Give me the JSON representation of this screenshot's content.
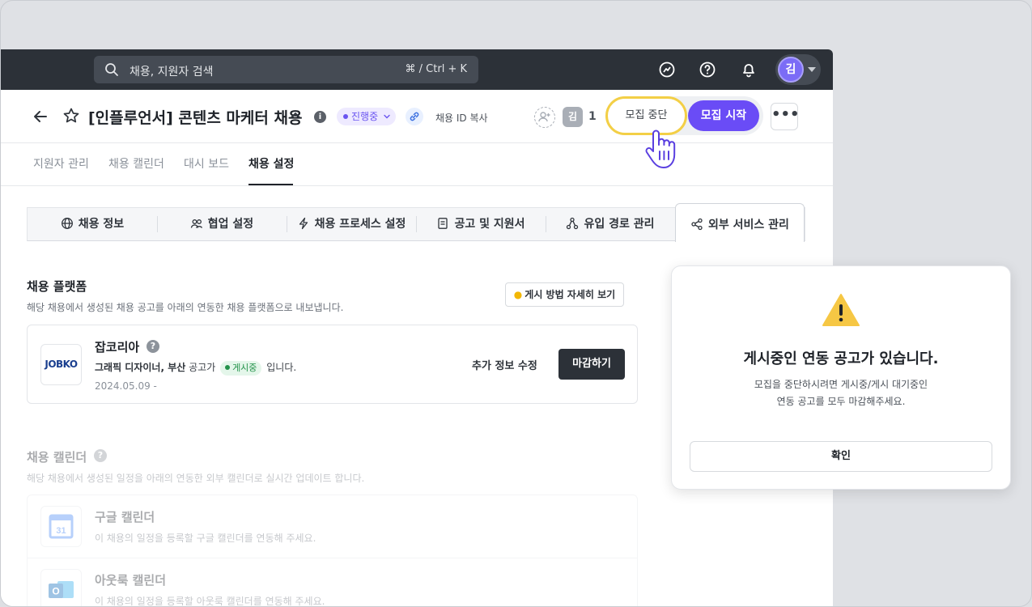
{
  "topbar": {
    "search_placeholder": "채용, 지원자 검색",
    "search_shortcut": "⌘ / Ctrl + K",
    "avatar_initial": "김"
  },
  "header": {
    "job_title": "[인플루언서] 콘텐츠 마케터 채용",
    "status_label": "진행중",
    "copy_id_label": "채용 ID 복사",
    "member_initial": "김",
    "member_count": "1",
    "stop_button": "모집 중단",
    "start_button": "모집 시작",
    "more_label": "•••"
  },
  "tabs": [
    {
      "label": "지원자 관리"
    },
    {
      "label": "채용 캘린더"
    },
    {
      "label": "대시 보드"
    },
    {
      "label": "채용 설정",
      "active": true
    }
  ],
  "subtabs": [
    {
      "label": "채용 정보",
      "icon": "globe-icon"
    },
    {
      "label": "협업 설정",
      "icon": "people-icon"
    },
    {
      "label": "채용 프로세스 설정",
      "icon": "lightning-icon"
    },
    {
      "label": "공고 및 지원서",
      "icon": "document-icon"
    },
    {
      "label": "유입 경로 관리",
      "icon": "network-icon"
    },
    {
      "label": "외부 서비스 관리",
      "icon": "share-icon",
      "active": true
    }
  ],
  "platform": {
    "title": "채용 플랫폼",
    "description": "해당 채용에서 생성된 채용 공고를 아래의 연동한 채용 플랫폼으로 내보냅니다.",
    "guide_button": "게시 방법 자세히 보기",
    "card": {
      "logo_text": "JOBKO",
      "name": "잡코리아",
      "post_title": "그래픽 디자이너, 부산",
      "post_suffix": "공고가",
      "status": "게시중",
      "tail": "입니다.",
      "date": "2024.05.09 -",
      "edit_label": "추가 정보 수정",
      "close_label": "마감하기"
    }
  },
  "calendar": {
    "title": "채용 캘린더",
    "description": "해당 채용에서 생성된 일정을 아래의 연동한 외부 캘린더로 실시간 업데이트 합니다.",
    "items": [
      {
        "name": "구글 캘린더",
        "desc": "이 채용의 일정을 등록할 구글 캘린더를 연동해 주세요.",
        "logo_text": "31"
      },
      {
        "name": "아웃룩 캘린더",
        "desc": "이 채용의 일정을 등록할 아웃룩 캘린더를 연동해 주세요.",
        "logo_text": "O"
      }
    ]
  },
  "modal": {
    "title": "게시중인 연동 공고가 있습니다.",
    "message_line1": "모집을 중단하시려면 게시중/게시 대기중인",
    "message_line2": "연동 공고를 모두 마감해주세요.",
    "confirm": "확인"
  },
  "colors": {
    "accent": "#6a4cf6",
    "highlight": "#f3cf46",
    "topbar": "#2c3138",
    "warning": "#f6c744"
  }
}
